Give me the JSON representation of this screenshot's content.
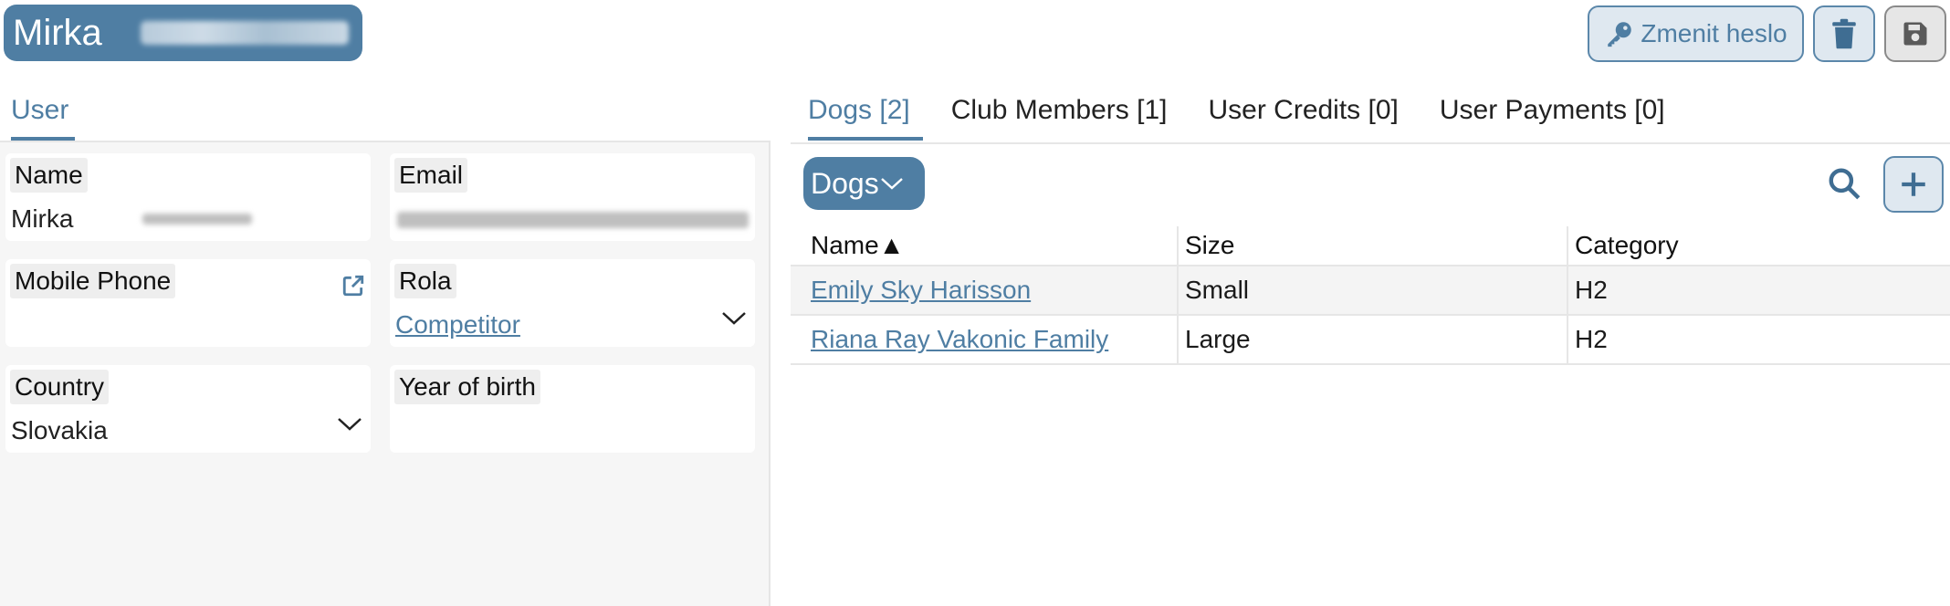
{
  "header": {
    "title": "Mirka",
    "change_password_label": "Zmenit heslo"
  },
  "left_tabs": [
    {
      "label": "User"
    }
  ],
  "form": {
    "name": {
      "label": "Name",
      "value": "Mirka"
    },
    "email": {
      "label": "Email"
    },
    "mobile_phone": {
      "label": "Mobile Phone"
    },
    "rola": {
      "label": "Rola",
      "value": "Competitor"
    },
    "country": {
      "label": "Country",
      "value": "Slovakia"
    },
    "year_of_birth": {
      "label": "Year of birth"
    }
  },
  "right_tabs": [
    {
      "label": "Dogs [2]",
      "active": true
    },
    {
      "label": "Club Members [1]"
    },
    {
      "label": "User Credits [0]"
    },
    {
      "label": "User Payments [0]"
    }
  ],
  "dogs_panel": {
    "dropdown_label": "Dogs",
    "columns": [
      "Name▲",
      "Size",
      "Category"
    ],
    "rows": [
      {
        "name": "Emily Sky Harisson",
        "size": "Small",
        "category": "H2"
      },
      {
        "name": "Riana Ray Vakonic Family",
        "size": "Large",
        "category": "H2"
      }
    ]
  },
  "colors": {
    "accent": "#4f7ea3",
    "accent_light": "#dfe8f0"
  }
}
